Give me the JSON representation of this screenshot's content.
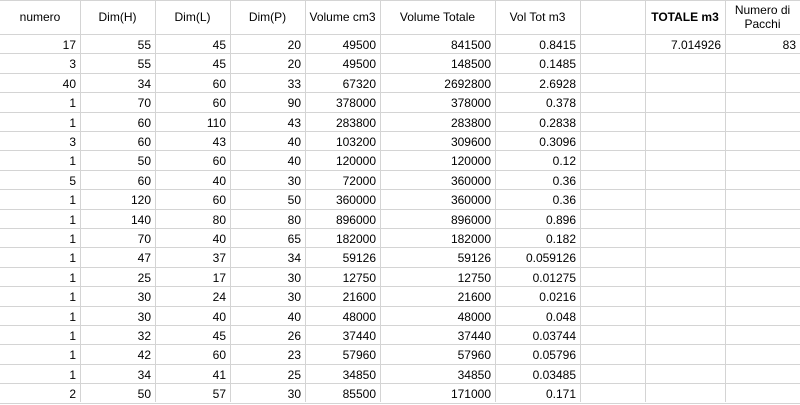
{
  "headers": {
    "numero": "numero",
    "dim_h": "Dim(H)",
    "dim_l": "Dim(L)",
    "dim_p": "Dim(P)",
    "volume_cm3": "Volume cm3",
    "volume_totale": "Volume Totale",
    "vol_tot_m3": "Vol Tot m3",
    "totale_m3": "TOTALE m3",
    "numero_pacchi": "Numero di Pacchi"
  },
  "summary": {
    "totale_m3": "7.014926",
    "numero_pacchi": "83"
  },
  "rows": [
    [
      "17",
      "55",
      "45",
      "20",
      "49500",
      "841500",
      "0.8415"
    ],
    [
      "3",
      "55",
      "45",
      "20",
      "49500",
      "148500",
      "0.1485"
    ],
    [
      "40",
      "34",
      "60",
      "33",
      "67320",
      "2692800",
      "2.6928"
    ],
    [
      "1",
      "70",
      "60",
      "90",
      "378000",
      "378000",
      "0.378"
    ],
    [
      "1",
      "60",
      "110",
      "43",
      "283800",
      "283800",
      "0.2838"
    ],
    [
      "3",
      "60",
      "43",
      "40",
      "103200",
      "309600",
      "0.3096"
    ],
    [
      "1",
      "50",
      "60",
      "40",
      "120000",
      "120000",
      "0.12"
    ],
    [
      "5",
      "60",
      "40",
      "30",
      "72000",
      "360000",
      "0.36"
    ],
    [
      "1",
      "120",
      "60",
      "50",
      "360000",
      "360000",
      "0.36"
    ],
    [
      "1",
      "140",
      "80",
      "80",
      "896000",
      "896000",
      "0.896"
    ],
    [
      "1",
      "70",
      "40",
      "65",
      "182000",
      "182000",
      "0.182"
    ],
    [
      "1",
      "47",
      "37",
      "34",
      "59126",
      "59126",
      "0.059126"
    ],
    [
      "1",
      "25",
      "17",
      "30",
      "12750",
      "12750",
      "0.01275"
    ],
    [
      "1",
      "30",
      "24",
      "30",
      "21600",
      "21600",
      "0.0216"
    ],
    [
      "1",
      "30",
      "40",
      "40",
      "48000",
      "48000",
      "0.048"
    ],
    [
      "1",
      "32",
      "45",
      "26",
      "37440",
      "37440",
      "0.03744"
    ],
    [
      "1",
      "42",
      "60",
      "23",
      "57960",
      "57960",
      "0.05796"
    ],
    [
      "1",
      "34",
      "41",
      "25",
      "34850",
      "34850",
      "0.03485"
    ],
    [
      "2",
      "50",
      "57",
      "30",
      "85500",
      "171000",
      "0.171"
    ]
  ]
}
